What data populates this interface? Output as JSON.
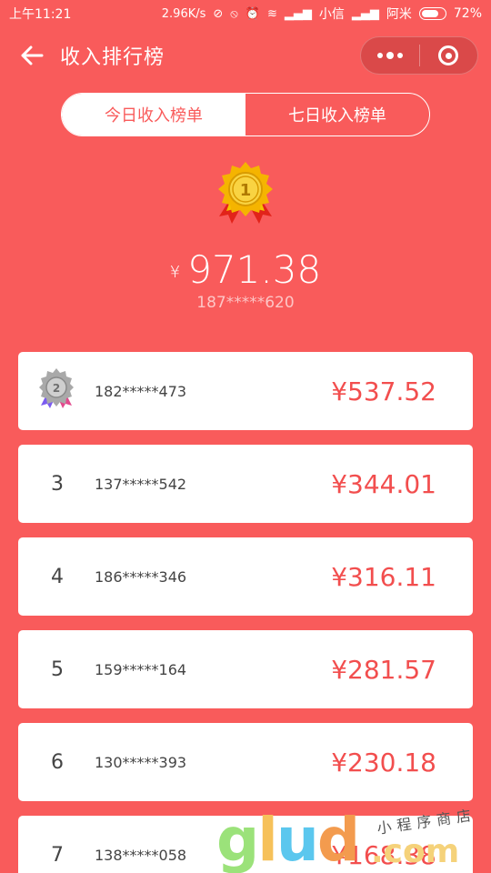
{
  "status_bar": {
    "time": "上午11:21",
    "speed": "2.96K/s",
    "carrier1": "小信",
    "carrier2": "阿米",
    "battery": "72%"
  },
  "nav": {
    "title": "收入排行榜",
    "back_icon": "arrow-left-icon",
    "menu_icon": "more-dots-icon",
    "close_icon": "target-circle-icon"
  },
  "tabs": [
    {
      "label": "今日收入榜单",
      "active": true
    },
    {
      "label": "七日收入榜单",
      "active": false
    }
  ],
  "top": {
    "rank_icon": "gold-medal-1-icon",
    "currency": "¥",
    "amount": "971.38",
    "phone": "187*****620"
  },
  "list": [
    {
      "rank": "",
      "medal": "silver-medal-2-icon",
      "phone": "182*****473",
      "amount": "¥537.52"
    },
    {
      "rank": "3",
      "phone": "137*****542",
      "amount": "¥344.01"
    },
    {
      "rank": "4",
      "phone": "186*****346",
      "amount": "¥316.11"
    },
    {
      "rank": "5",
      "phone": "159*****164",
      "amount": "¥281.57"
    },
    {
      "rank": "6",
      "phone": "130*****393",
      "amount": "¥230.18"
    },
    {
      "rank": "7",
      "phone": "138*****058",
      "amount": "¥168.38"
    }
  ],
  "watermark": {
    "main": "glud",
    "suffix": ".com",
    "tagline": "小程序商店"
  },
  "colors": {
    "background": "#F95B5B",
    "accent_text": "#F24E4E",
    "gold": "#F5B400",
    "silver": "#9E9E9E"
  }
}
